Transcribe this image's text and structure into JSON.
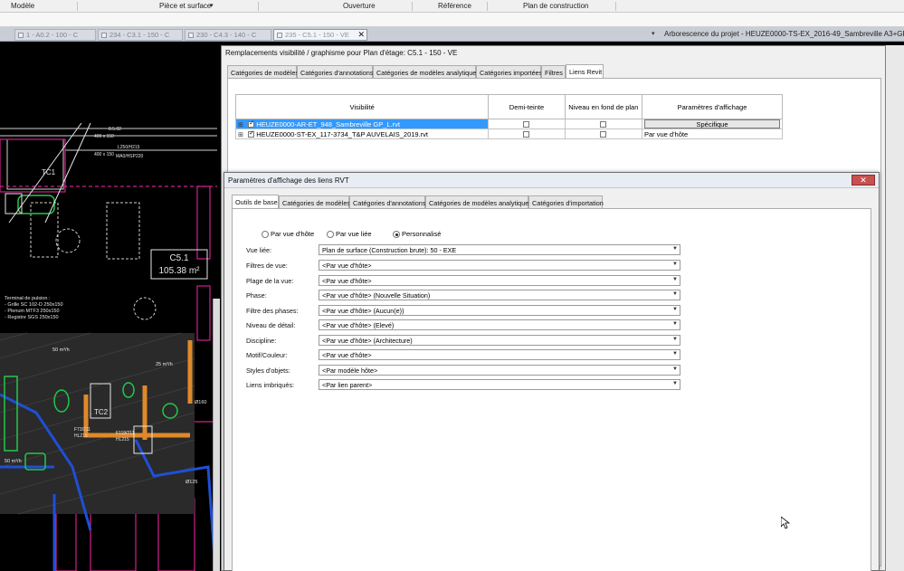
{
  "ribbon": {
    "items": [
      "Modèle",
      "Pièce et surface",
      "Ouverture",
      "Référence",
      "Plan de construction"
    ],
    "dropdown_marker": "▾"
  },
  "doc_tabs": [
    {
      "label": "1 - A0.2 - 100 - C",
      "active": false
    },
    {
      "label": "234 - C3.1 - 150 - C",
      "active": false
    },
    {
      "label": "230 - C4.3 - 140 - C",
      "active": false
    },
    {
      "label": "235 - C5.1 - 150 - VE",
      "active": true
    }
  ],
  "doc_tab_close": "✕",
  "project_tree_title": "Arborescence du projet - HEUZE0000-TS-EX_2016-49_Sambreville A3+GP_D.rvt",
  "canvas": {
    "room_name": "C5.1",
    "room_area": "105.38 m²",
    "labels": [
      "L250/H215",
      "MA0/HSP220",
      "TC1",
      "TC2",
      "Terminal de pulsion :",
      "- Grille SC 102-D 250x150",
      "- Plenum MTF3 250x150",
      "- Registre SGS 250x150",
      "50 m³/h",
      "Ø160",
      "Ø125",
      "F73/211",
      "HL215",
      "F119/211",
      "HL215",
      "25 m³/h",
      "8.5.02",
      "400 x 150",
      "400 x 150",
      "50 m³/h"
    ]
  },
  "dialog1": {
    "title": "Remplacements visibilité / graphisme pour Plan d'étage: C5.1 - 150 - VE",
    "tabs": [
      "Catégories de modèles",
      "Catégories d'annotations",
      "Catégories de modèles analytiques",
      "Catégories importées",
      "Filtres",
      "Liens Revit"
    ],
    "active_tab": "Liens Revit",
    "table": {
      "headers": [
        "Visibilité",
        "Demi-teinte",
        "Niveau en fond de plan",
        "Paramètres d'affichage"
      ],
      "rows": [
        {
          "name": "HEUZE0000-AR-ET_948_Sambreville GP_L.rvt",
          "visible": true,
          "halftone": false,
          "underlay": false,
          "display": "Spécifique",
          "selected": true
        },
        {
          "name": "HEUZE0000-ST-EX_117-3734_T&P AUVELAIS_2019.rvt",
          "visible": true,
          "halftone": false,
          "underlay": false,
          "display": "Par vue d'hôte",
          "selected": false
        }
      ]
    }
  },
  "dialog2": {
    "title": "Paramètres d'affichage des liens RVT",
    "close_label": "✕",
    "tabs": [
      "Outils de base",
      "Catégories de modèles",
      "Catégories d'annotations",
      "Catégories de modèles analytiques",
      "Catégories d'importation"
    ],
    "active_tab": "Outils de base",
    "radios": [
      {
        "label": "Par vue d'hôte",
        "checked": false
      },
      {
        "label": "Par vue liée",
        "checked": false
      },
      {
        "label": "Personnalisé",
        "checked": true
      }
    ],
    "properties": [
      {
        "label": "Vue liée:",
        "value": "Plan de surface (Construction brute): 50 - EXE"
      },
      {
        "label": "Filtres de vue:",
        "value": "<Par vue d'hôte>"
      },
      {
        "label": "Plage de la vue:",
        "value": "<Par vue d'hôte>"
      },
      {
        "label": "Phase:",
        "value": "<Par vue d'hôte> (Nouvelle Situation)"
      },
      {
        "label": "Filtre des phases:",
        "value": "<Par vue d'hôte> (Aucun(e))"
      },
      {
        "label": "Niveau de détail:",
        "value": "<Par vue d'hôte> (Elevé)"
      },
      {
        "label": "Discipline:",
        "value": "<Par vue d'hôte> (Architecture)"
      },
      {
        "label": "Motif/Couleur:",
        "value": "<Par vue d'hôte>"
      },
      {
        "label": "Styles d'objets:",
        "value": "<Par modèle hôte>"
      },
      {
        "label": "Liens imbriqués:",
        "value": "<Par lien parent>"
      }
    ]
  },
  "colors": {
    "selection": "#3399ff",
    "cad_background": "#000000",
    "duct_blue": "#1f4fd6",
    "duct_orange": "#e0892a",
    "green": "#22c84a",
    "magenta": "#d0208c"
  }
}
